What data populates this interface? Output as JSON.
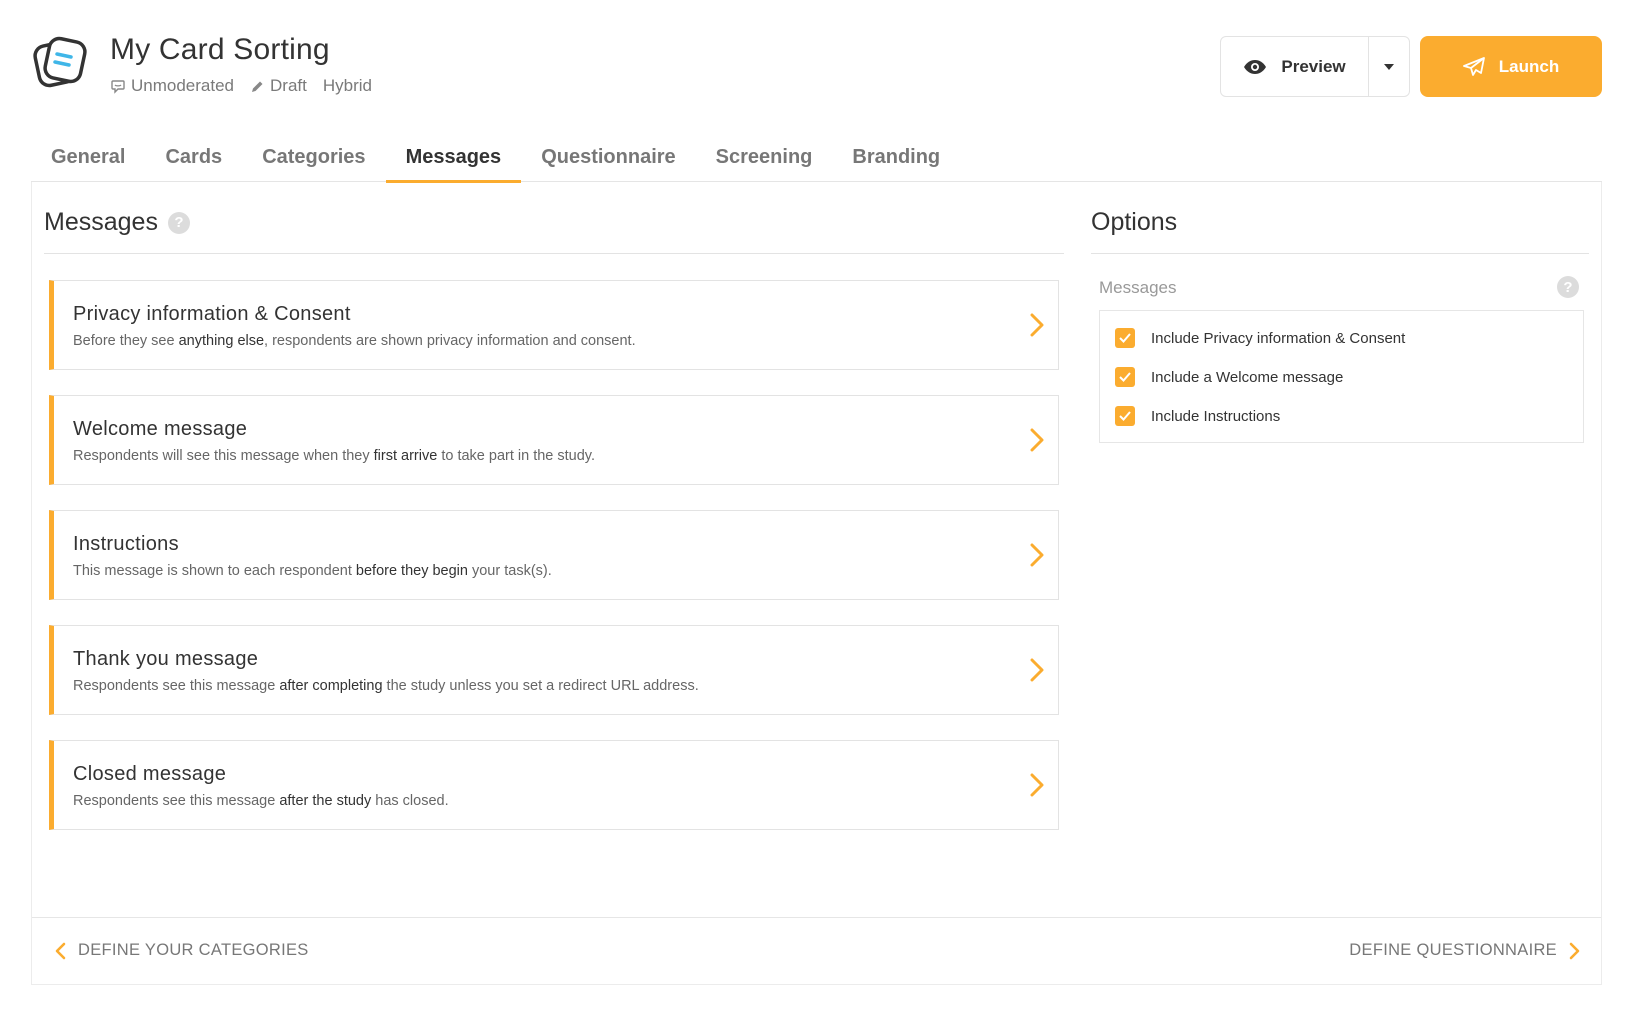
{
  "header": {
    "title": "My Card Sorting",
    "meta": {
      "mode": "Unmoderated",
      "status": "Draft",
      "type": "Hybrid"
    },
    "preview_label": "Preview",
    "launch_label": "Launch",
    "accent_color": "#fbac2f"
  },
  "tabs": [
    {
      "label": "General"
    },
    {
      "label": "Cards"
    },
    {
      "label": "Categories"
    },
    {
      "label": "Messages",
      "active": true
    },
    {
      "label": "Questionnaire"
    },
    {
      "label": "Screening"
    },
    {
      "label": "Branding"
    }
  ],
  "messages": {
    "title": "Messages",
    "items": [
      {
        "title": "Privacy information & Consent",
        "desc_before": "Before they see ",
        "desc_bold": "anything else",
        "desc_after": ", respondents are shown privacy information and consent."
      },
      {
        "title": "Welcome message",
        "desc_before": "Respondents will see this message when they ",
        "desc_bold": "first arrive",
        "desc_after": " to take part in the study."
      },
      {
        "title": "Instructions",
        "desc_before": "This message is shown to each respondent ",
        "desc_bold": "before they begin",
        "desc_after": " your task(s)."
      },
      {
        "title": "Thank you message",
        "desc_before": "Respondents see this message ",
        "desc_bold": "after completing",
        "desc_after": " the study unless you set a redirect URL address."
      },
      {
        "title": "Closed message",
        "desc_before": "Respondents see this message ",
        "desc_bold": "after the study",
        "desc_after": " has closed."
      }
    ]
  },
  "options": {
    "title": "Options",
    "group_label": "Messages",
    "checkboxes": [
      {
        "label": "Include Privacy information & Consent",
        "checked": true
      },
      {
        "label": "Include a Welcome message",
        "checked": true
      },
      {
        "label": "Include Instructions",
        "checked": true
      }
    ]
  },
  "footer": {
    "prev_label": "DEFINE YOUR CATEGORIES",
    "next_label": "DEFINE QUESTIONNAIRE"
  }
}
